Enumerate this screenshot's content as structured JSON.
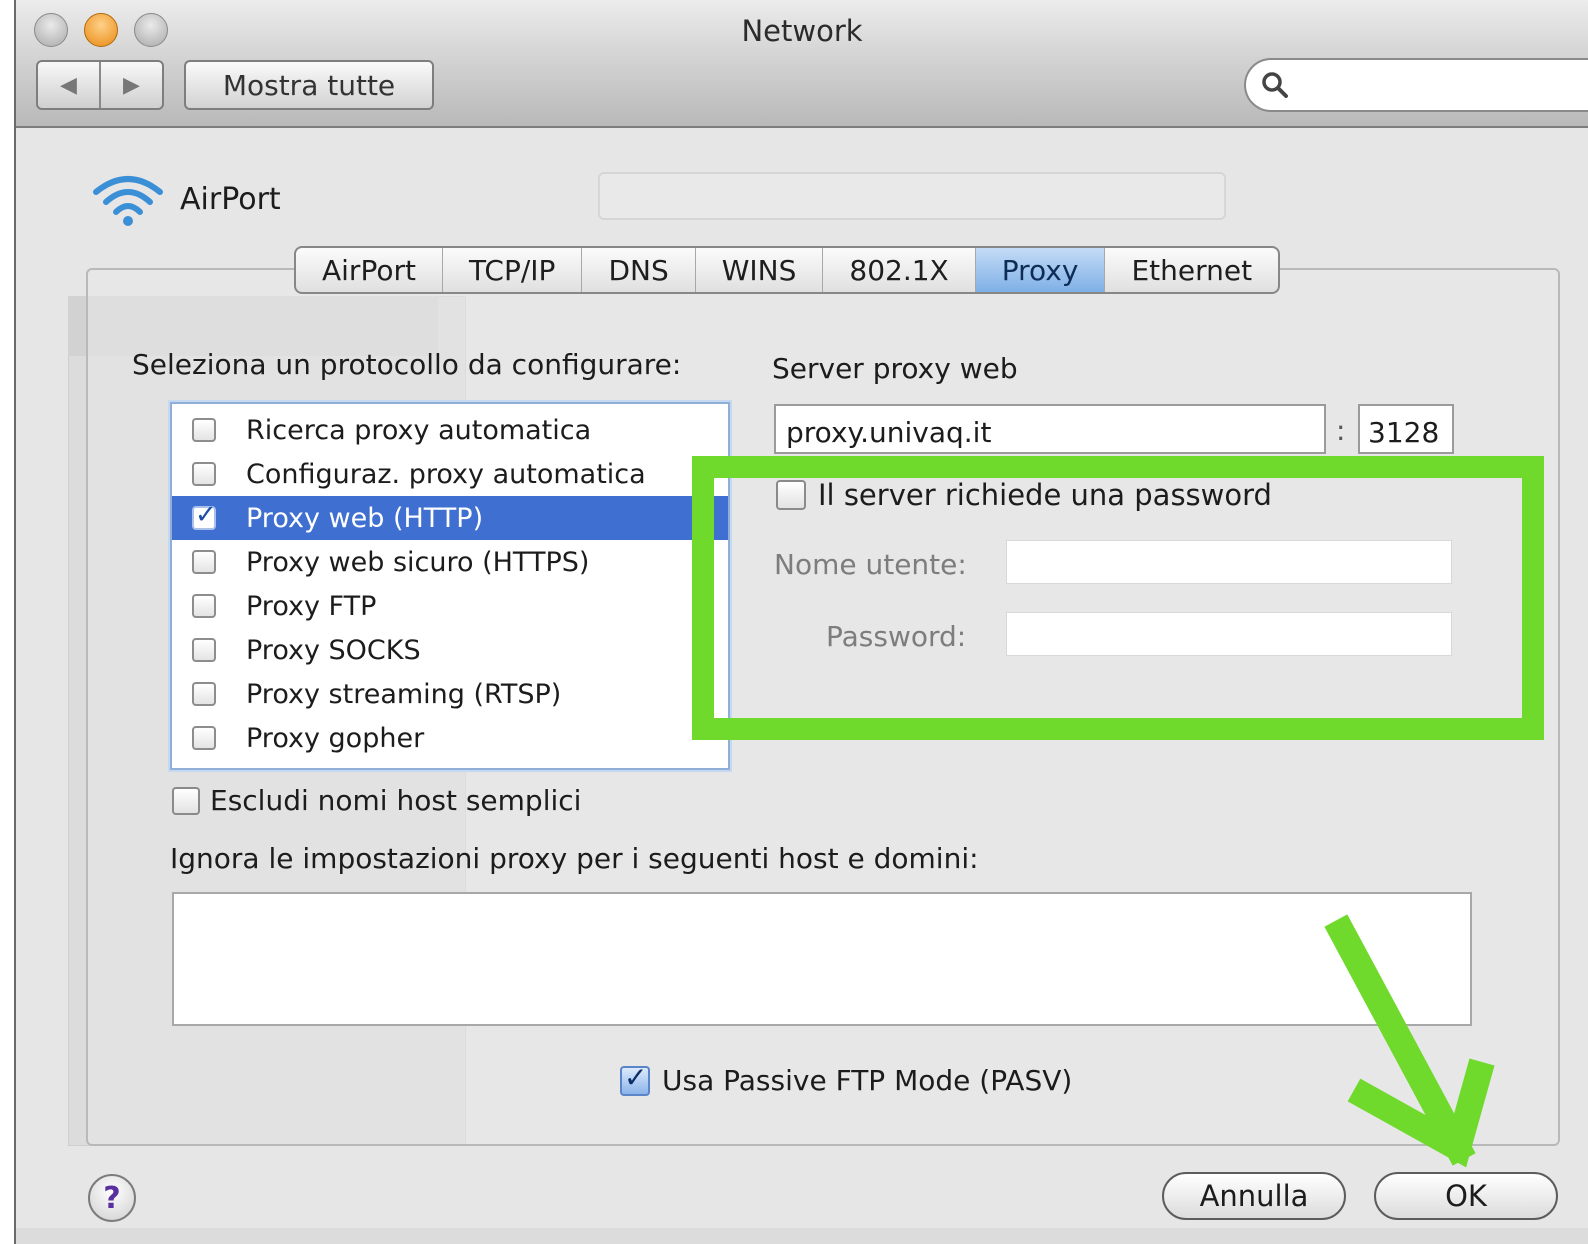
{
  "window": {
    "title": "Network",
    "show_all_label": "Mostra tutte",
    "search_placeholder": ""
  },
  "service": {
    "name": "AirPort"
  },
  "tabs": [
    {
      "label": "AirPort",
      "active": false
    },
    {
      "label": "TCP/IP",
      "active": false
    },
    {
      "label": "DNS",
      "active": false
    },
    {
      "label": "WINS",
      "active": false
    },
    {
      "label": "802.1X",
      "active": false
    },
    {
      "label": "Proxy",
      "active": true
    },
    {
      "label": "Ethernet",
      "active": false
    }
  ],
  "protocols": {
    "label": "Seleziona un protocollo da configurare:",
    "items": [
      {
        "label": "Ricerca proxy automatica",
        "checked": false,
        "selected": false
      },
      {
        "label": "Configuraz. proxy automatica",
        "checked": false,
        "selected": false
      },
      {
        "label": "Proxy web (HTTP)",
        "checked": true,
        "selected": true
      },
      {
        "label": "Proxy web sicuro (HTTPS)",
        "checked": false,
        "selected": false
      },
      {
        "label": "Proxy FTP",
        "checked": false,
        "selected": false
      },
      {
        "label": "Proxy SOCKS",
        "checked": false,
        "selected": false
      },
      {
        "label": "Proxy streaming (RTSP)",
        "checked": false,
        "selected": false
      },
      {
        "label": "Proxy gopher",
        "checked": false,
        "selected": false
      }
    ]
  },
  "server": {
    "label": "Server proxy web",
    "host": "proxy.univaq.it",
    "port_separator": ":",
    "port": "3128",
    "password_required_label": "Il server richiede una password",
    "password_required": false,
    "username_label": "Nome utente:",
    "username_value": "",
    "password_label": "Password:",
    "password_value": ""
  },
  "options": {
    "exclude_simple_hosts_label": "Escludi nomi host semplici",
    "exclude_simple_hosts": false,
    "bypass_label": "Ignora le impostazioni proxy per i seguenti host e domini:",
    "bypass_value": "",
    "pasv_label": "Usa Passive FTP Mode (PASV)",
    "pasv": true
  },
  "buttons": {
    "help": "?",
    "cancel": "Annulla",
    "ok": "OK"
  },
  "colors": {
    "highlight": "#6fd92c",
    "selection": "#3f6fd0",
    "active_tab": "#7fb0e6"
  },
  "icons": {
    "back": "chevron-left-icon",
    "forward": "chevron-right-icon",
    "search": "search-icon",
    "wifi": "wifi-icon",
    "arrow": "down-arrow-annotation"
  }
}
